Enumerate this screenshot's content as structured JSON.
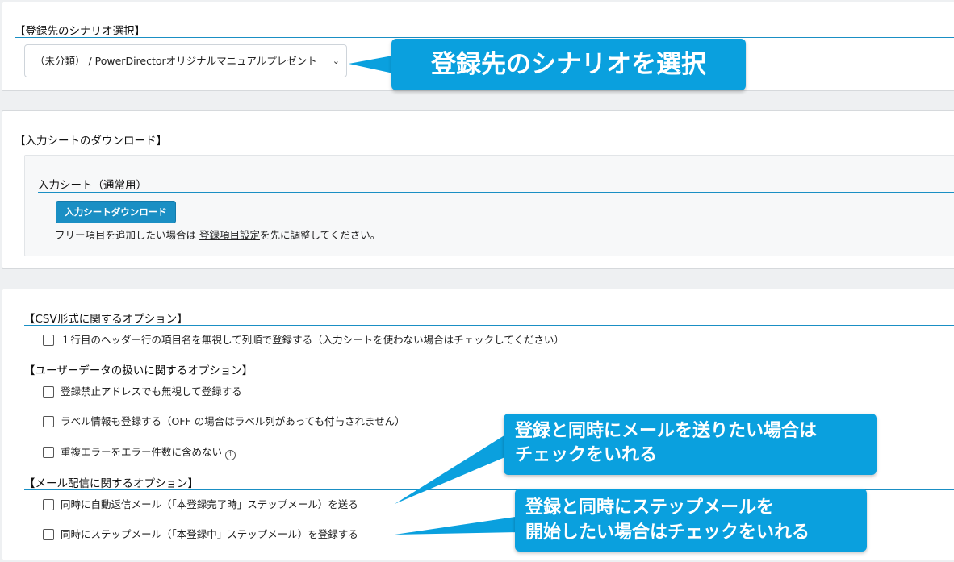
{
  "scenario_section": {
    "title": "【登録先のシナリオ選択】",
    "selected_value": "（未分類） / PowerDirectorオリジナルマニュアルプレゼント"
  },
  "download_section": {
    "title": "【入力シートのダウンロード】",
    "sheet_title": "入力シート（通常用）",
    "download_button": "入力シートダウンロード",
    "note_prefix": "フリー項目を追加したい場合は ",
    "note_link": "登録項目設定",
    "note_suffix": "を先に調整してください。"
  },
  "options_section": {
    "csv_title": "【CSV形式に関するオプション】",
    "csv_options": [
      {
        "label": "１行目のヘッダー行の項目名を無視して列順で登録する（入力シートを使わない場合はチェックしてください）",
        "checked": false
      }
    ],
    "user_title": "【ユーザーデータの扱いに関するオプション】",
    "user_options": [
      {
        "label": "登録禁止アドレスでも無視して登録する",
        "checked": false
      },
      {
        "label": "ラベル情報も登録する（OFF の場合はラベル列があっても付与されません）",
        "checked": false
      },
      {
        "label": "重複エラーをエラー件数に含めない",
        "checked": false
      }
    ],
    "info_icon": "i",
    "mail_title": "【メール配信に関するオプション】",
    "mail_options": [
      {
        "label": "同時に自動返信メール（「本登録完了時」ステップメール）を送る",
        "checked": false
      },
      {
        "label": "同時にステップメール（「本登録中」ステップメール）を登録する",
        "checked": false
      }
    ]
  },
  "callouts": {
    "scenario": "登録先のシナリオを選択",
    "auto_reply_line1": "登録と同時にメールを送りたい場合は",
    "auto_reply_line2": "チェックをいれる",
    "step_mail_line1": "登録と同時にステップメールを",
    "step_mail_line2": "開始したい場合はチェックをいれる"
  },
  "colors": {
    "accent": "#1a8fc4",
    "callout": "#0aa0de"
  }
}
